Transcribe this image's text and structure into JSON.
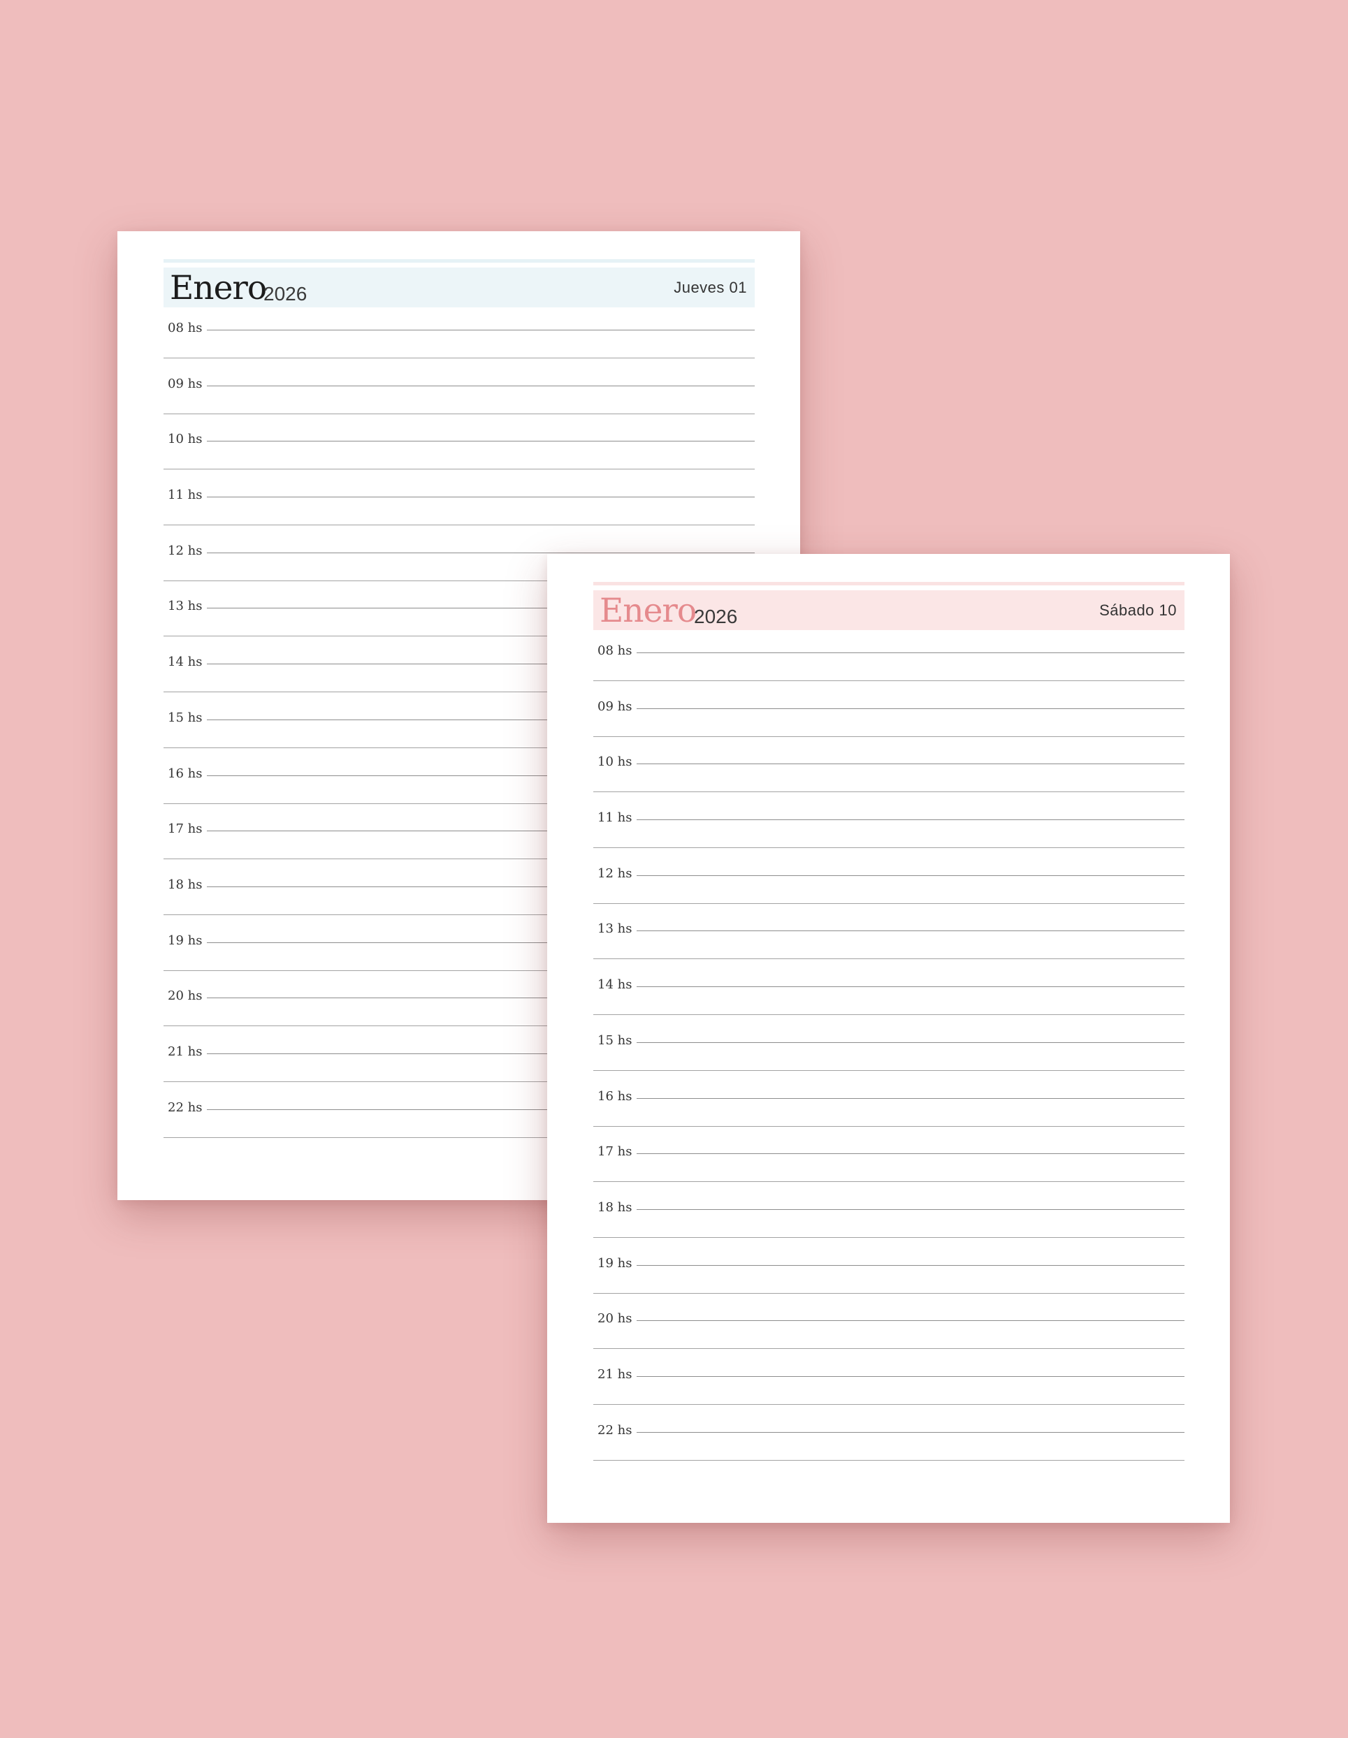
{
  "background_color": "#efbdbd",
  "sheets": [
    {
      "month": "Enero",
      "year": "2026",
      "day": "Jueves 01",
      "header_bg": "#ecf5f8",
      "top_rule_color": "#e6f2f6",
      "month_color": "#1c1c1c"
    },
    {
      "month": "Enero",
      "year": "2026",
      "day": "Sábado 10",
      "header_bg": "#fbe6e6",
      "top_rule_color": "#fae2e2",
      "month_color": "#e58a8d"
    }
  ],
  "hours": [
    "08 hs",
    "09 hs",
    "10 hs",
    "11 hs",
    "12 hs",
    "13 hs",
    "14 hs",
    "15 hs",
    "16 hs",
    "17 hs",
    "18 hs",
    "19 hs",
    "20 hs",
    "21 hs",
    "22 hs"
  ]
}
